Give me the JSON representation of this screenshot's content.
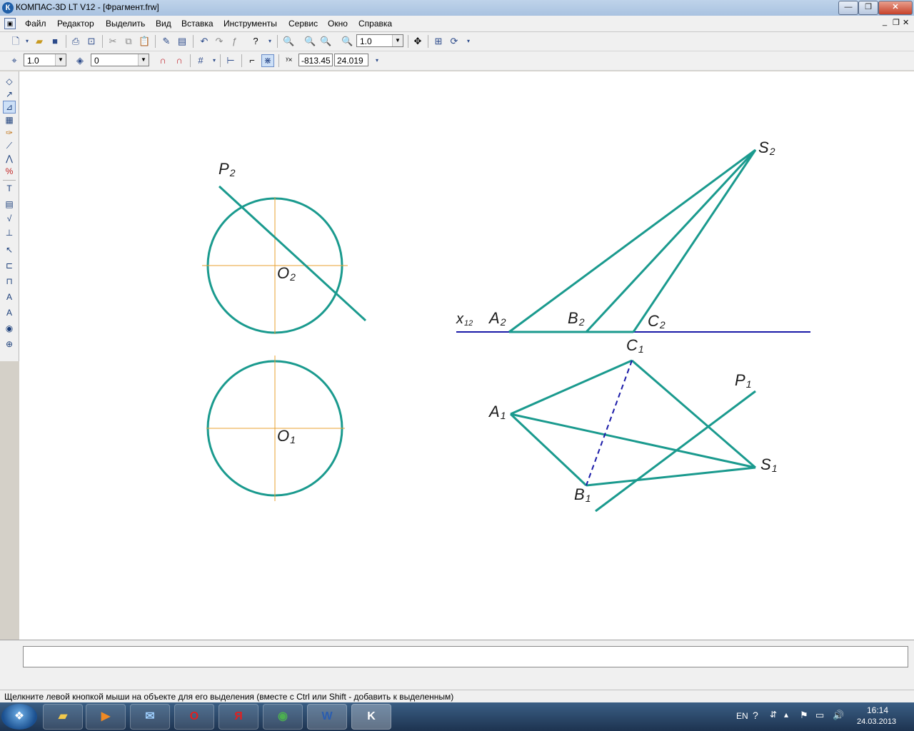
{
  "window": {
    "title": "КОМПАС-3D LT V12 - [Фрагмент.frw]",
    "app_icon": "К"
  },
  "window_buttons": {
    "minimize": "—",
    "restore": "❐",
    "close": "✕"
  },
  "menu": [
    "Файл",
    "Редактор",
    "Выделить",
    "Вид",
    "Вставка",
    "Инструменты",
    "Сервис",
    "Окно",
    "Справка"
  ],
  "mdi_buttons": {
    "minimize": "_",
    "restore": "❐",
    "close": "✕"
  },
  "toolbar1": {
    "zoom_value": "1.0"
  },
  "toolbar2": {
    "step_value": "1.0",
    "layer_value": "0",
    "coord_x": "-813.45",
    "coord_y": "24.019"
  },
  "drawing": {
    "labels": {
      "P2": {
        "main": "P",
        "sub": "2"
      },
      "O2": {
        "main": "O",
        "sub": "2"
      },
      "O1": {
        "main": "O",
        "sub": "1"
      },
      "S2": {
        "main": "S",
        "sub": "2"
      },
      "x12": {
        "main": "x",
        "sub": "12"
      },
      "A2": {
        "main": "A",
        "sub": "2"
      },
      "B2": {
        "main": "B",
        "sub": "2"
      },
      "C2": {
        "main": "C",
        "sub": "2"
      },
      "C1": {
        "main": "C",
        "sub": "1"
      },
      "P1": {
        "main": "P",
        "sub": "1"
      },
      "A1": {
        "main": "A",
        "sub": "1"
      },
      "S1": {
        "main": "S",
        "sub": "1"
      },
      "B1": {
        "main": "B",
        "sub": "1"
      }
    },
    "colors": {
      "main_line": "#1a9a8e",
      "axis_line": "#1a1aa8",
      "center_line": "#e8a030",
      "hidden_line": "#1a1aa8"
    }
  },
  "status": "Щелкните левой кнопкой мыши на объекте для его выделения (вместе с Ctrl или Shift - добавить к выделенным)",
  "taskbar": {
    "apps": [
      "explorer",
      "media-player",
      "mail",
      "opera",
      "yandex",
      "chrome",
      "word",
      "kompas"
    ],
    "lang": "EN",
    "time": "16:14",
    "date": "24.03.2013"
  }
}
